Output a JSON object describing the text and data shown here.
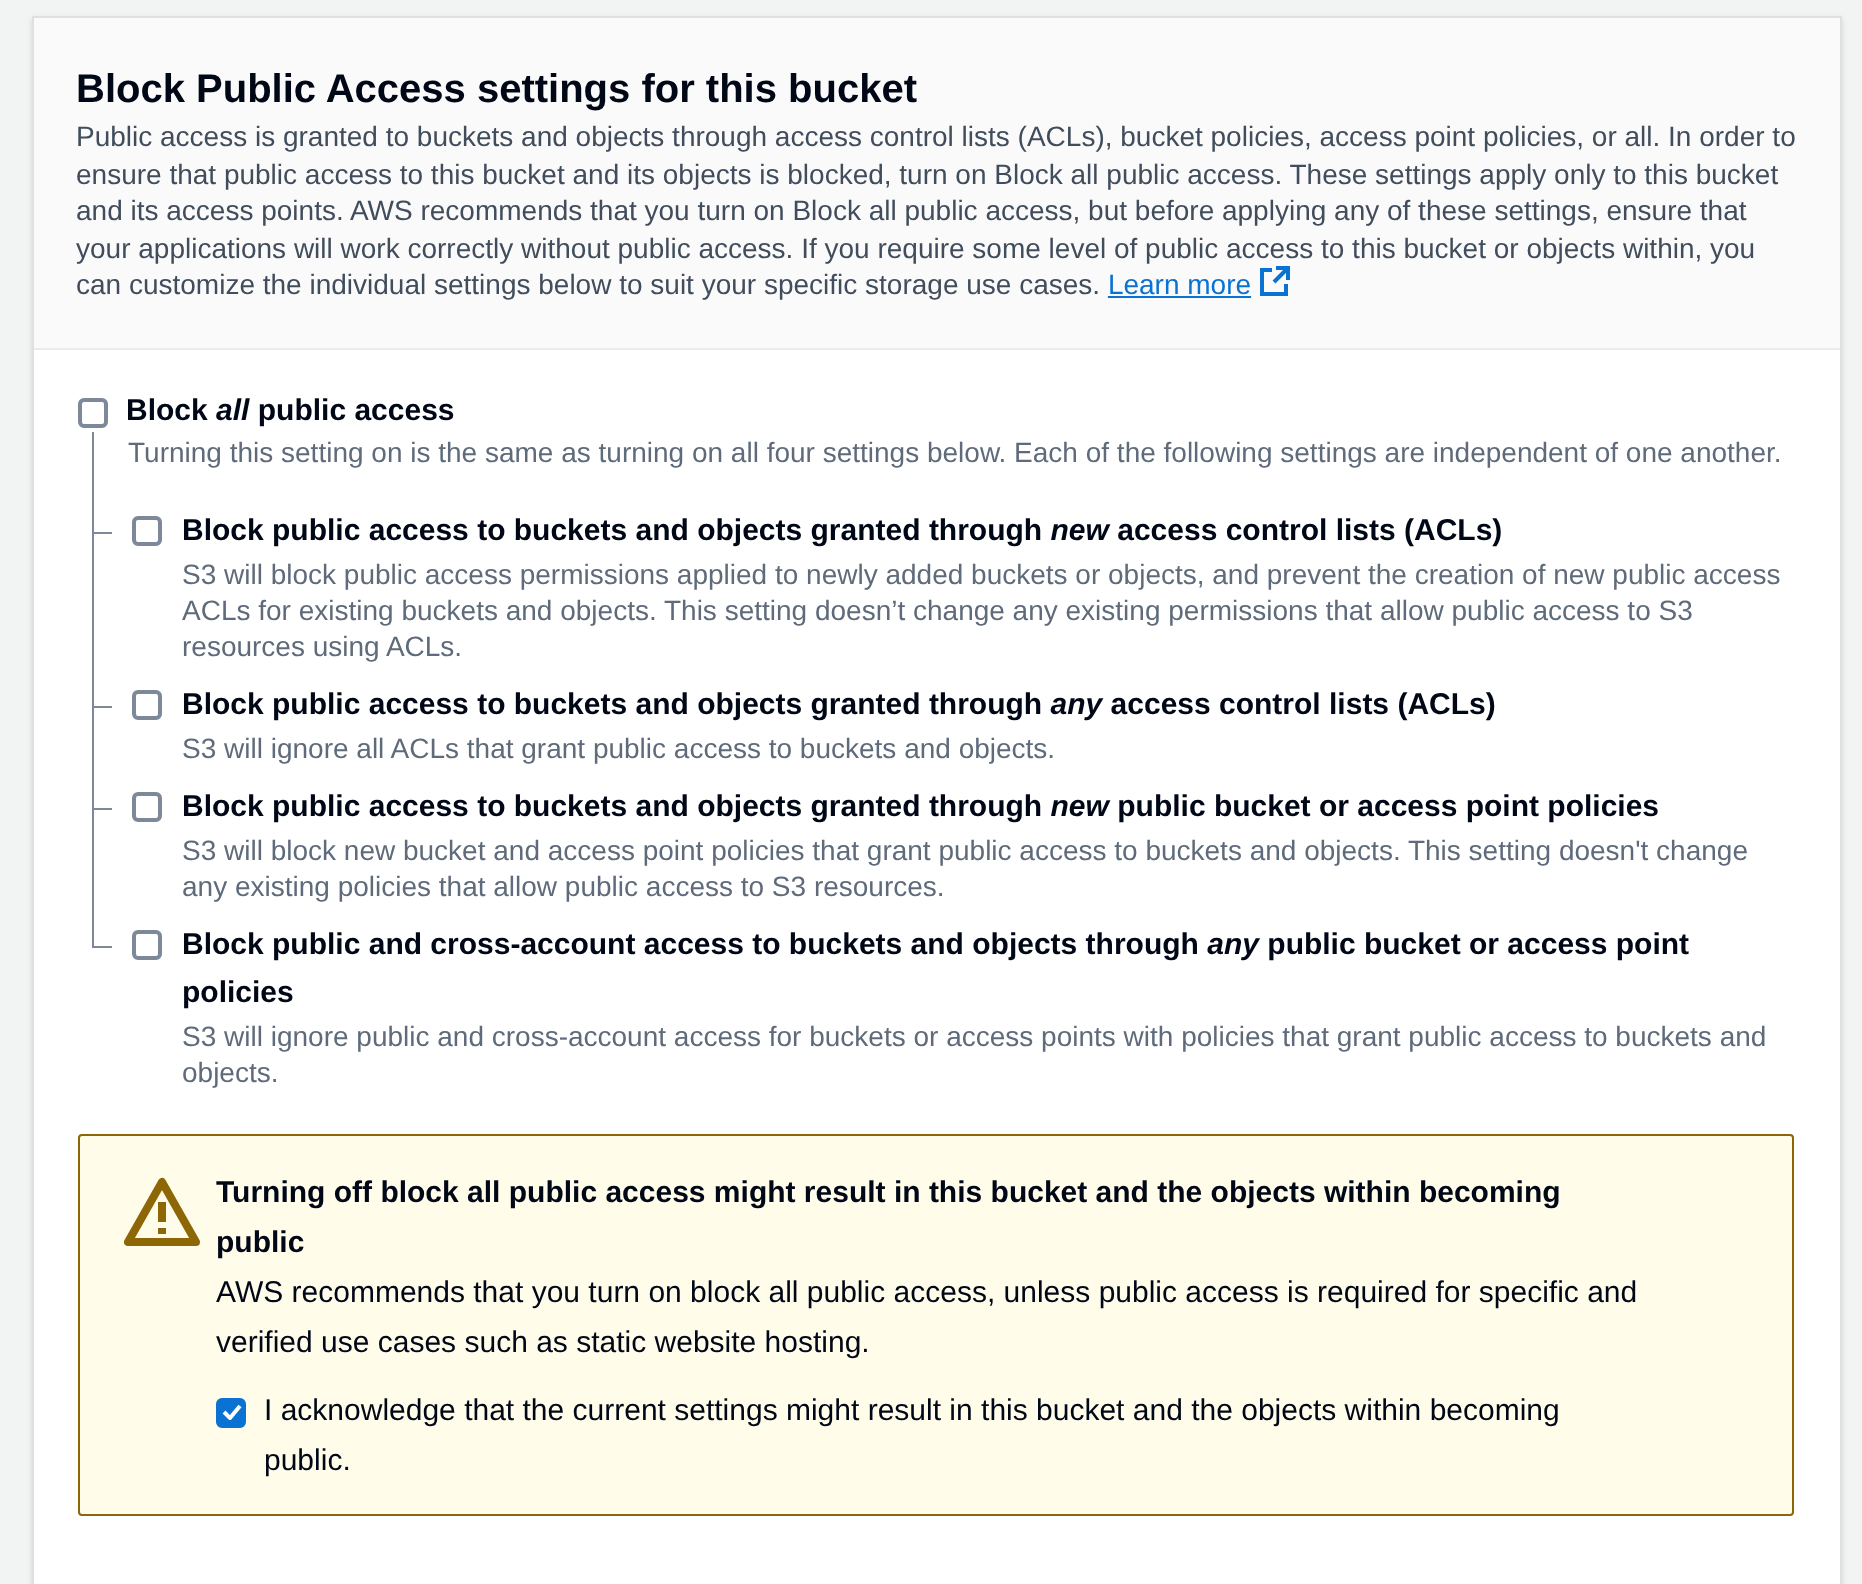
{
  "header": {
    "title": "Block Public Access settings for this bucket",
    "description": "Public access is granted to buckets and objects through access control lists (ACLs), bucket policies, access point policies, or all. In order to ensure that public access to this bucket and its objects is blocked, turn on Block all public access. These settings apply only to this bucket and its access points. AWS recommends that you turn on Block all public access, but before applying any of these settings, ensure that your applications will work correctly without public access. If you require some level of public access to this bucket or objects within, you can customize the individual settings below to suit your specific storage use cases.",
    "link": "Learn more"
  },
  "block_all": {
    "label": "Block *all* public access",
    "description": "Turning this setting on is the same as turning on all four settings below. Each of the following settings are independent of one another.",
    "checked": false,
    "children": [
      {
        "label": "Block public access to buckets and objects granted through *new* access control lists (ACLs)",
        "description": "S3 will block public access permissions applied to newly added buckets or objects, and prevent the creation of new public access ACLs for existing buckets and objects. This setting doesn’t change any existing permissions that allow public access to S3 resources using ACLs.",
        "checked": false
      },
      {
        "label": "Block public access to buckets and objects granted through *any* access control lists (ACLs)",
        "description": "S3 will ignore all ACLs that grant public access to buckets and objects.",
        "checked": false
      },
      {
        "label": "Block public access to buckets and objects granted through *new* public bucket or access point policies",
        "description": "S3 will block new bucket and access point policies that grant public access to buckets and objects. This setting doesn't change any existing policies that allow public access to S3 resources.",
        "checked": false
      },
      {
        "label": "Block public and cross-account access to buckets and objects through *any* public bucket or access point policies",
        "description": "S3 will ignore public and cross-account access for buckets or access points with policies that grant public access to buckets and objects.",
        "checked": false
      }
    ]
  },
  "warning": {
    "title": "Turning off block all public access might result in this bucket and the objects within becoming public",
    "body": "AWS recommends that you turn on block all public access, unless public access is required for specific and verified use cases such as static website hosting.",
    "acknowledge": {
      "label": "I acknowledge that the current settings might result in this bucket and the objects within becoming public.",
      "checked": true
    }
  }
}
